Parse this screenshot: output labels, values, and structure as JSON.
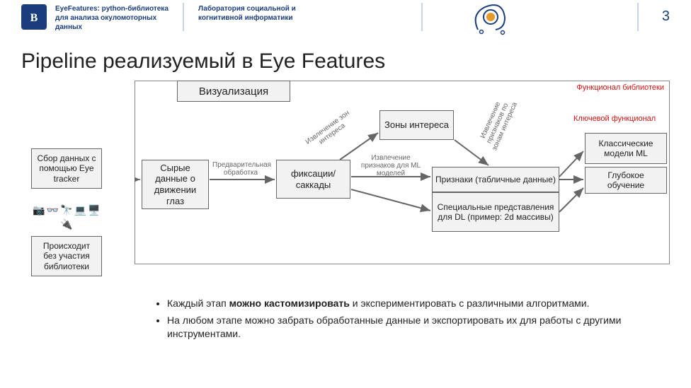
{
  "header": {
    "sub1": "EyeFeatures: python-библиотека для анализа окуломоторных данных",
    "sub2": "Лаборатория социальной и когнитивной информатики",
    "page": "3"
  },
  "title": "Pipeline реализуемый в Eye Features",
  "legend": {
    "lib_functional": "Функционал библиотеки",
    "key_functional": "Ключевой функционал"
  },
  "boxes": {
    "viz": "Визуализация",
    "collect": "Сбор данных с помощью Eye tracker",
    "without_lib": "Происходит без участия библиотеки",
    "raw": "Сырые данные о движении глаз",
    "fix_sac": "фиксации/ саккады",
    "aoi": "Зоны интереса",
    "feats_tab": "Признаки (табличные данные)",
    "special_rep": "Специальные представления для DL (пример: 2d массивы)",
    "classic_ml": "Классические модели ML",
    "deep": "Глубокое обучение"
  },
  "edge_labels": {
    "preproc": "Предварительная обработка",
    "extract_aoi": "Извлечение зон интереса",
    "extract_feats_ml": "Извлечение признаков для ML моделей",
    "extract_feats_aoi": "Извлечение признаков по зонам интереса"
  },
  "bullets": [
    "Каждый этап <b>можно кастомизировать</b> и экспериментировать с различными алгоритмами.",
    "На любом этапе можно забрать обработанные данные и экспортировать их для работы с другими инструментами."
  ]
}
